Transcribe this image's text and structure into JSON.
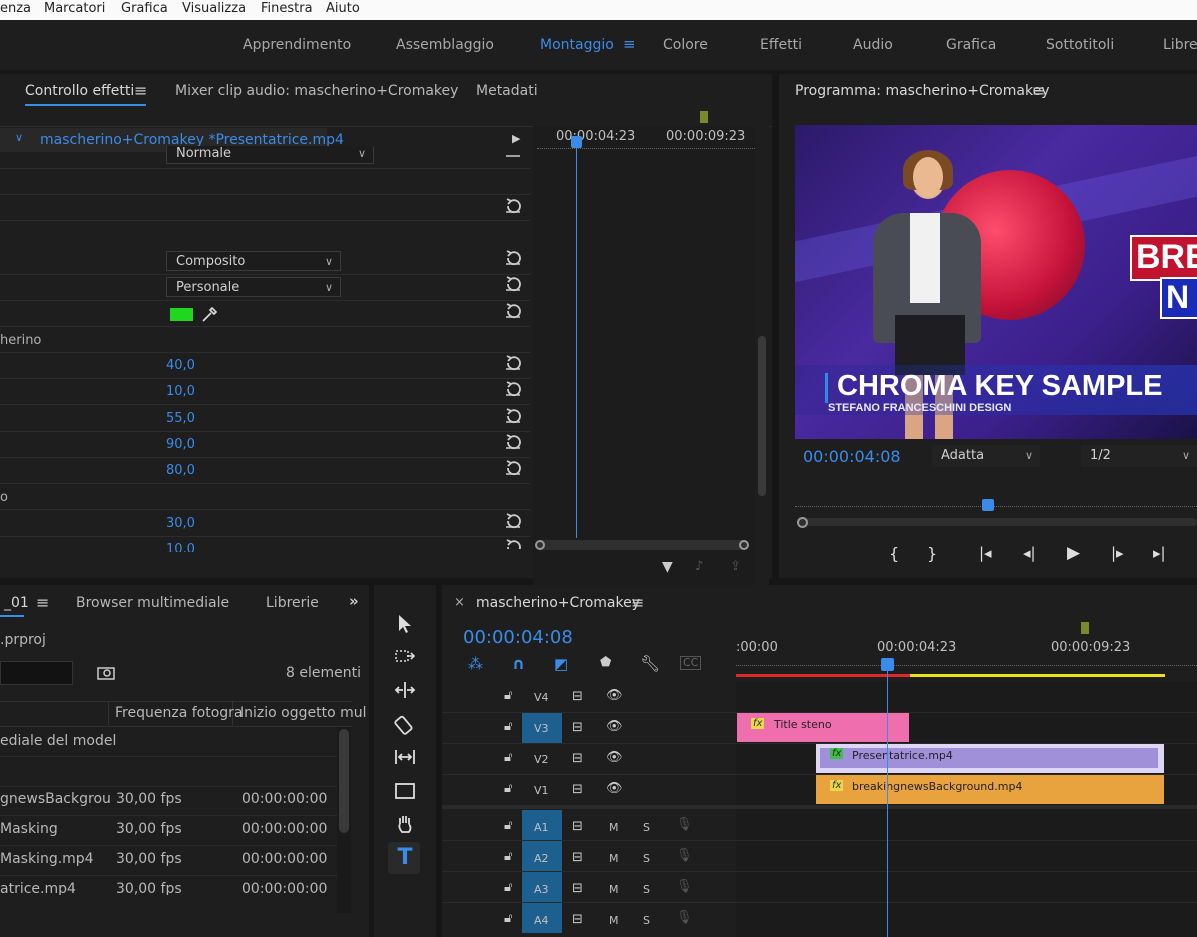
{
  "menu": [
    "enza",
    "Marcatori",
    "Grafica",
    "Visualizza",
    "Finestra",
    "Aiuto"
  ],
  "workspaces": [
    {
      "label": "Apprendimento"
    },
    {
      "label": "Assemblaggio"
    },
    {
      "label": "Montaggio",
      "active": true
    },
    {
      "label": "Colore"
    },
    {
      "label": "Effetti"
    },
    {
      "label": "Audio"
    },
    {
      "label": "Grafica"
    },
    {
      "label": "Sottotitoli"
    },
    {
      "label": "Libre"
    }
  ],
  "effects": {
    "tab_active": "Controllo effetti",
    "tab_mixer": "Mixer clip audio: mascherino+Cromakey",
    "tab_meta": "Metadati",
    "clip_path": "mascherino+Cromakey *Presentatrice.mp4",
    "tc_a": "00:00:04:23",
    "tc_b": "00:00:09:23",
    "blend": "Normale",
    "composito": "Composito",
    "personale": "Personale",
    "section_mask": "herino",
    "section_o": "o",
    "values": [
      "40,0",
      "10,0",
      "55,0",
      "90,0",
      "80,0",
      "30,0",
      "10,0"
    ]
  },
  "program": {
    "title": "Programma: mascherino+Cromakey",
    "timecode": "00:00:04:08",
    "fit": "Adatta",
    "res": "1/2",
    "breaking": "BREA",
    "news": "N",
    "chroma": "CHROMA KEY SAMPLE",
    "design": "STEFANO FRANCESCHINI DESIGN"
  },
  "project": {
    "tab1": "_01",
    "tab2": "Browser multimediale",
    "tab3": "Librerie",
    "file": ".prproj",
    "count": "8 elementi",
    "col_rate": "Frequenza fotogra",
    "col_start": "Inizio oggetto mul",
    "folder": "ediale del model",
    "rows": [
      {
        "name": "gnewsBackgrou",
        "rate": "30,00 fps",
        "start": "00:00:00:00"
      },
      {
        "name": "Masking",
        "rate": "30,00 fps",
        "start": "00:00:00:00"
      },
      {
        "name": "Masking.mp4",
        "rate": "30,00 fps",
        "start": "00:00:00:00"
      },
      {
        "name": "atrice.mp4",
        "rate": "30,00 fps",
        "start": "00:00:00:00"
      }
    ]
  },
  "timeline": {
    "tab": "mascherino+Cromakey",
    "timecode": "00:00:04:08",
    "ruler": [
      ":00:00",
      "00:00:04:23",
      "00:00:09:23"
    ],
    "video_tracks": [
      "V4",
      "V3",
      "V2",
      "V1"
    ],
    "audio_tracks": [
      "A1",
      "A2",
      "A3",
      "A4"
    ],
    "clips": {
      "title": "Title steno",
      "presentatrice": "Presentatrice.mp4",
      "background": "breakingnewsBackground.mp4"
    },
    "m": "M",
    "s": "S",
    "fx": "fx"
  },
  "colors": {
    "accent": "#2d8ceb",
    "key_green": "#1ed71e",
    "clip_pink": "#ef6fae",
    "clip_purple": "#a08fd9",
    "clip_orange": "#e8a23e"
  }
}
